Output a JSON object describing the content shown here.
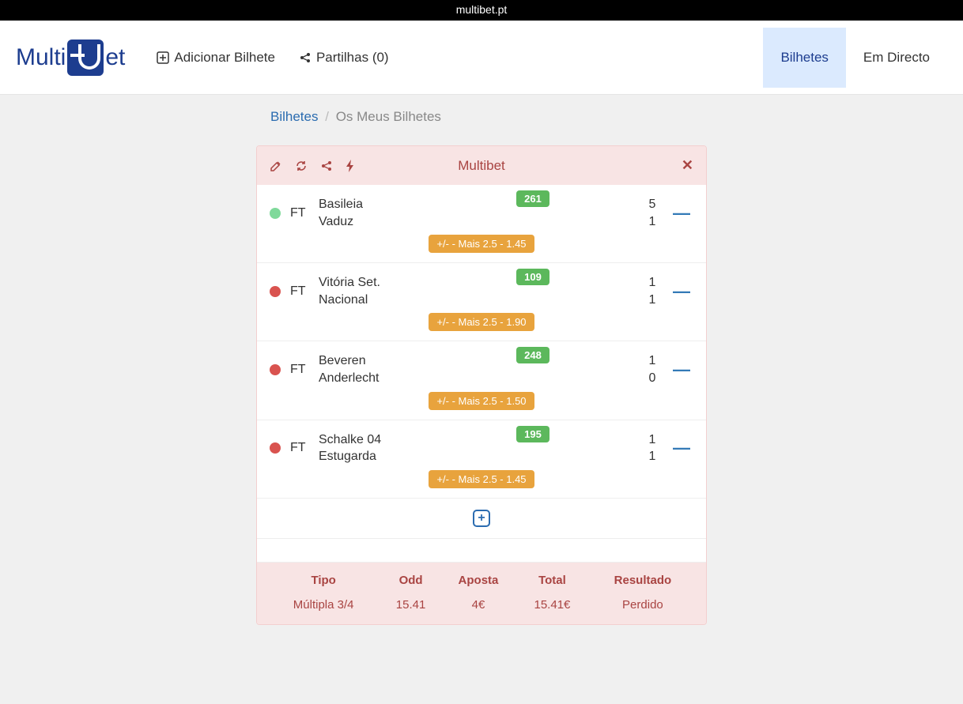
{
  "url_bar": "multibet.pt",
  "logo": {
    "part1": "Multi",
    "part2": "et"
  },
  "nav": {
    "add_ticket": "Adicionar Bilhete",
    "shares": "Partilhas (0)",
    "tab_bilhetes": "Bilhetes",
    "tab_live": "Em Directo"
  },
  "breadcrumb": {
    "root": "Bilhetes",
    "sep": "/",
    "current": "Os Meus Bilhetes"
  },
  "ticket": {
    "title": "Multibet",
    "bets": [
      {
        "status": "green",
        "ft": "FT",
        "home": "Basileia",
        "away": "Vaduz",
        "code": "261",
        "score_home": "5",
        "score_away": "1",
        "market": "+/- - Mais 2.5 - 1.45"
      },
      {
        "status": "red",
        "ft": "FT",
        "home": "Vitória Set.",
        "away": "Nacional",
        "code": "109",
        "score_home": "1",
        "score_away": "1",
        "market": "+/- - Mais 2.5 - 1.90"
      },
      {
        "status": "red",
        "ft": "FT",
        "home": "Beveren",
        "away": "Anderlecht",
        "code": "248",
        "score_home": "1",
        "score_away": "0",
        "market": "+/- - Mais 2.5 - 1.50"
      },
      {
        "status": "red",
        "ft": "FT",
        "home": "Schalke 04",
        "away": "Estugarda",
        "code": "195",
        "score_home": "1",
        "score_away": "1",
        "market": "+/- - Mais 2.5 - 1.45"
      }
    ],
    "summary": {
      "headers": {
        "type": "Tipo",
        "odd": "Odd",
        "stake": "Aposta",
        "total": "Total",
        "result": "Resultado"
      },
      "values": {
        "type": "Múltipla 3/4",
        "odd": "15.41",
        "stake": "4€",
        "total": "15.41€",
        "result": "Perdido"
      }
    }
  }
}
